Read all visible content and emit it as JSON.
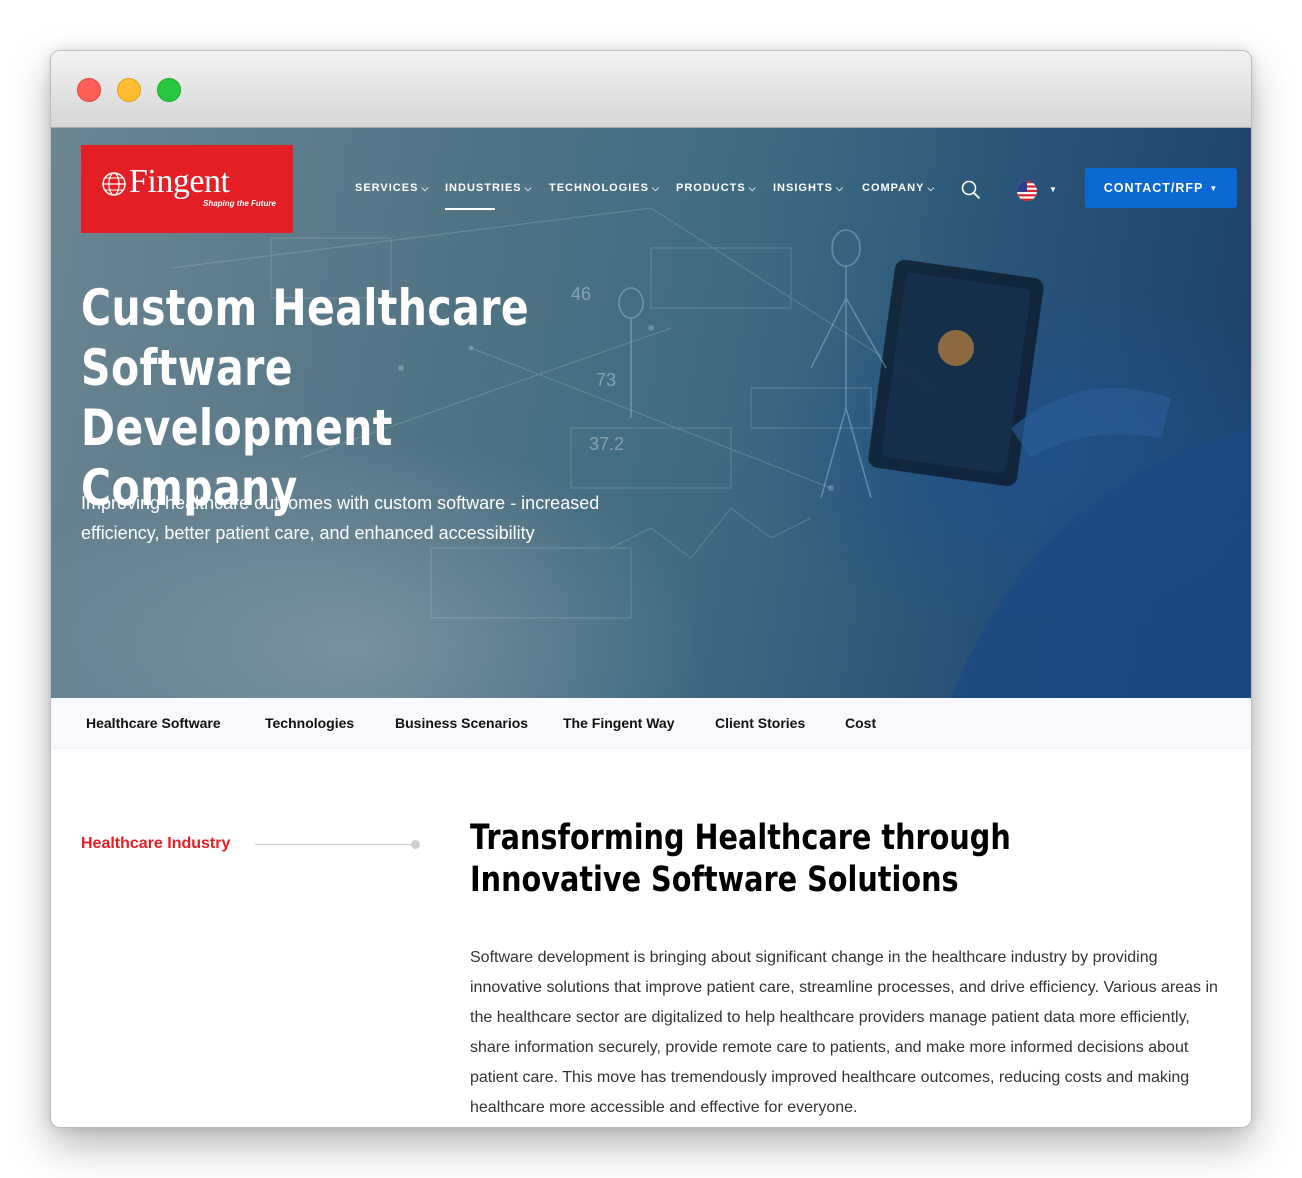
{
  "window": {
    "controls": [
      "close",
      "minimize",
      "maximize"
    ]
  },
  "brand": {
    "name": "Fingent",
    "tagline": "Shaping the Future",
    "color": "#e31e24"
  },
  "nav": {
    "items": [
      {
        "label": "SERVICES",
        "active": false
      },
      {
        "label": "INDUSTRIES",
        "active": true
      },
      {
        "label": "TECHNOLOGIES",
        "active": false
      },
      {
        "label": "PRODUCTS",
        "active": false
      },
      {
        "label": "INSIGHTS",
        "active": false
      },
      {
        "label": "COMPANY",
        "active": false
      }
    ],
    "search_icon": "search-icon",
    "language_icon": "us-flag-icon",
    "contact_label": "CONTACT/RFP",
    "contact_color": "#0b69d4"
  },
  "hero": {
    "title": "Custom Healthcare Software Development Company",
    "subtitle": "Improving healthcare outcomes with custom software - increased efficiency, better patient care, and enhanced accessibility"
  },
  "subnav": {
    "items": [
      "Healthcare Software",
      "Technologies",
      "Business Scenarios",
      "The Fingent Way",
      "Client Stories",
      "Cost"
    ]
  },
  "section": {
    "side_label": "Healthcare Industry",
    "title": "Transforming Healthcare through Innovative Software Solutions",
    "body": "Software development is bringing about significant change in the healthcare industry by providing innovative solutions that improve patient care, streamline processes, and drive efficiency. Various areas in the healthcare sector are digitalized to help healthcare providers manage patient data more efficiently, share information securely, provide remote care to patients, and make more informed decisions about patient care. This move has tremendously improved healthcare outcomes, reducing costs and making healthcare more accessible and effective for everyone."
  }
}
